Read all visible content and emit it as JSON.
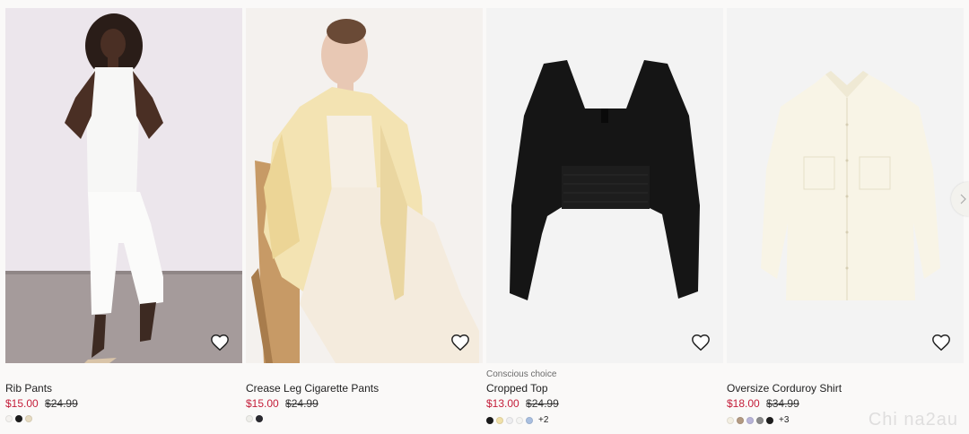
{
  "products": [
    {
      "tag": "",
      "name": "Rib Pants",
      "price": "$15.00",
      "original_price": "$24.99",
      "swatches": [
        "#f4f2ef",
        "#1c1c1c",
        "#e7dcc2"
      ],
      "more": ""
    },
    {
      "tag": "",
      "name": "Crease Leg Cigarette Pants",
      "price": "$15.00",
      "original_price": "$24.99",
      "swatches": [
        "#eeeeea",
        "#2a2a30"
      ],
      "more": ""
    },
    {
      "tag": "Conscious choice",
      "name": "Cropped Top",
      "price": "$13.00",
      "original_price": "$24.99",
      "swatches": [
        "#1a1a1a",
        "#f0e0a8",
        "#eeeef0",
        "#f4f4f2",
        "#a9bfe0"
      ],
      "more": "+2"
    },
    {
      "tag": "",
      "name": "Oversize Corduroy Shirt",
      "price": "$18.00",
      "original_price": "$34.99",
      "swatches": [
        "#f3efe2",
        "#b39a82",
        "#b8b4d8",
        "#8a8a8a",
        "#1e1e1e"
      ],
      "more": "+3"
    }
  ],
  "watermark": "Chi na2au",
  "colors": {
    "sale": "#c41e3a"
  }
}
